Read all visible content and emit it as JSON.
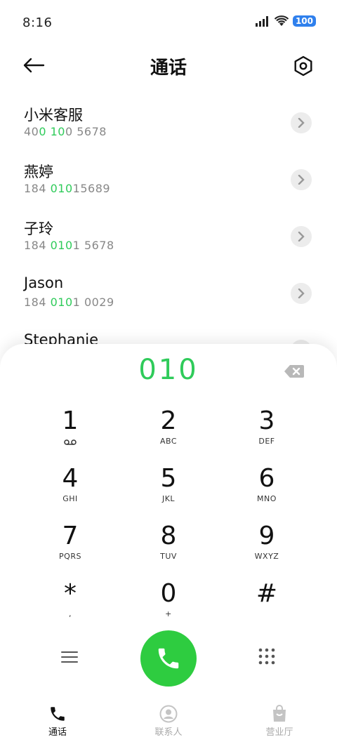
{
  "status_bar": {
    "time": "8:16",
    "battery": "100"
  },
  "header": {
    "title": "通话"
  },
  "contacts": [
    {
      "name": "小米客服",
      "num_pre": "40",
      "num_hl1": "0 10",
      "num_mid": "0 5678",
      "num_hl2": "",
      "num_post": ""
    },
    {
      "name": "燕婷",
      "num_pre": "184 ",
      "num_hl1": "010",
      "num_mid": "15689",
      "num_hl2": "",
      "num_post": ""
    },
    {
      "name": "子玲",
      "num_pre": "184 ",
      "num_hl1": "010",
      "num_mid": "1 5678",
      "num_hl2": "",
      "num_post": ""
    },
    {
      "name": "Jason",
      "num_pre": "184 ",
      "num_hl1": "010",
      "num_mid": "1 0029",
      "num_hl2": "",
      "num_post": ""
    },
    {
      "name": "Stephanie",
      "num_pre": "",
      "num_hl1": "",
      "num_mid": "",
      "num_hl2": "",
      "num_post": ""
    }
  ],
  "dialpad": {
    "entered_number": "010",
    "keys": [
      {
        "digit": "1",
        "letters": "voicemail"
      },
      {
        "digit": "2",
        "letters": "ABC"
      },
      {
        "digit": "3",
        "letters": "DEF"
      },
      {
        "digit": "4",
        "letters": "GHI"
      },
      {
        "digit": "5",
        "letters": "JKL"
      },
      {
        "digit": "6",
        "letters": "MNO"
      },
      {
        "digit": "7",
        "letters": "PQRS"
      },
      {
        "digit": "8",
        "letters": "TUV"
      },
      {
        "digit": "9",
        "letters": "WXYZ"
      },
      {
        "digit": "*",
        "letters": ","
      },
      {
        "digit": "0",
        "letters": "+"
      },
      {
        "digit": "#",
        "letters": ""
      }
    ]
  },
  "bottom_nav": {
    "tabs": [
      {
        "label": "通话",
        "icon": "phone-icon",
        "active": true
      },
      {
        "label": "联系人",
        "icon": "contact-icon",
        "active": false
      },
      {
        "label": "营业厅",
        "icon": "store-icon",
        "active": false
      }
    ]
  },
  "colors": {
    "accent": "#2fcb5a",
    "call_button": "#2ecc40",
    "battery": "#2f80ed",
    "muted": "#888888"
  }
}
